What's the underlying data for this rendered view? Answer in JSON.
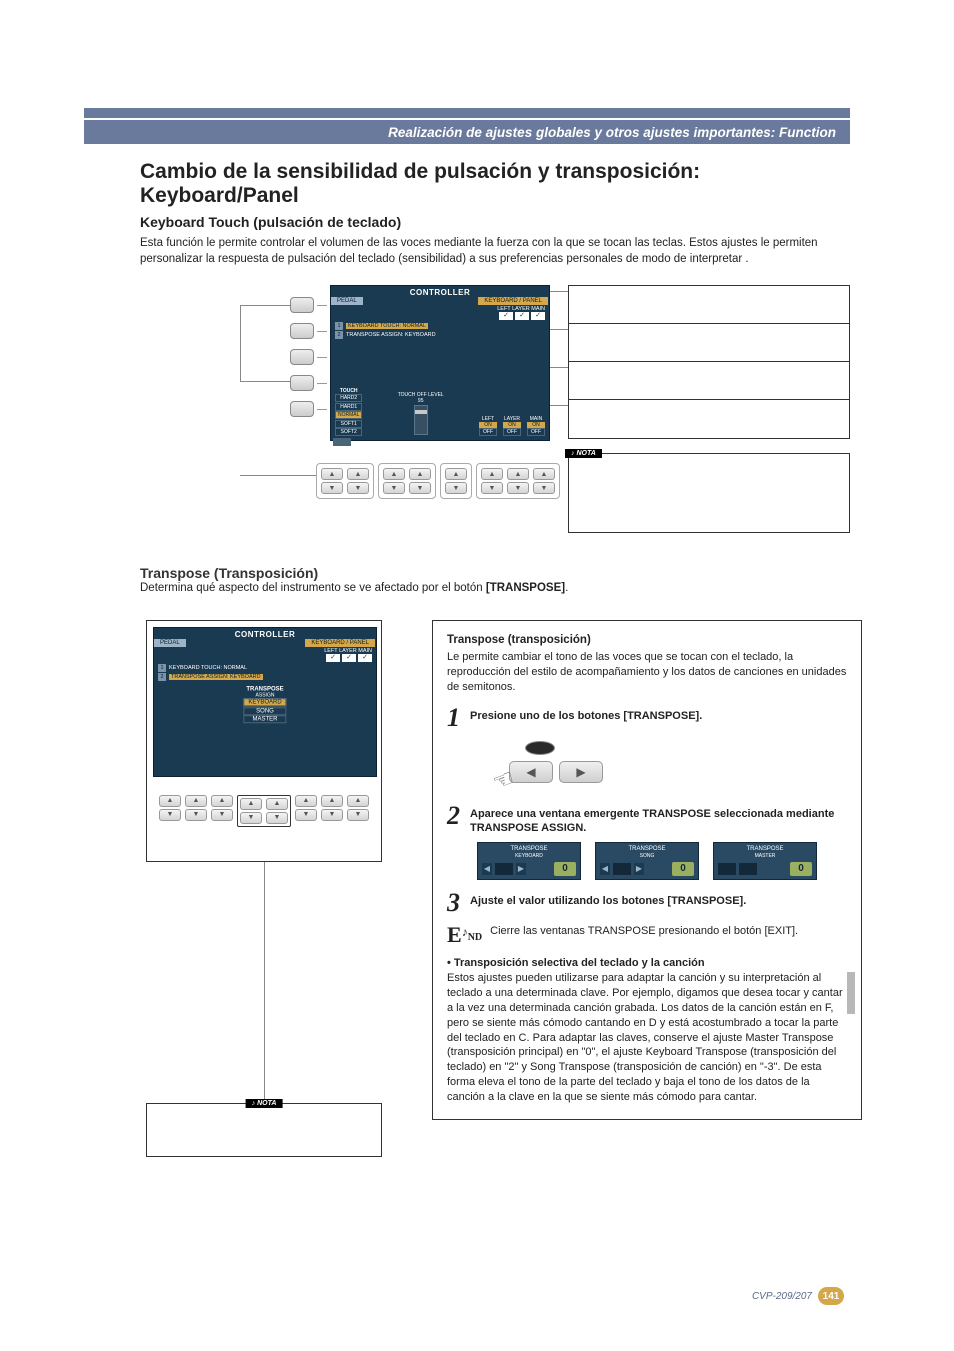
{
  "header": {
    "ribbon": "Realización de ajustes globales y otros ajustes importantes: Function"
  },
  "section1": {
    "title": "Cambio de la sensibilidad de pulsación y transposición: Keyboard/Panel",
    "subhead": "Keyboard Touch (pulsación de teclado)",
    "intro": "Esta función le permite controlar el volumen de las voces mediante la fuerza con la que se tocan las teclas. Estos ajustes le permiten personalizar la respuesta de pulsación del teclado (sensibilidad) a sus preferencias personales de modo de interpretar ."
  },
  "lcd1": {
    "title": "CONTROLLER",
    "tab_pedal": "PEDAL",
    "tab_kbd": "KEYBOARD / PANEL",
    "sub_checks": "LEFT  LAYER  MAIN",
    "row1_num": "1",
    "row1": "KEYBOARD TOUCH: NORMAL",
    "row2_num": "2",
    "row2": "TRANSPOSE ASSIGN: KEYBOARD",
    "touch_label": "TOUCH",
    "touch_opts": [
      "HARD2",
      "HARD1",
      "NORMAL",
      "SOFT1",
      "SOFT2"
    ],
    "touch_selected": "NORMAL",
    "touchoff_label": "TOUCH OFF LEVEL",
    "touchoff_value": "95",
    "cols": [
      {
        "name": "LEFT",
        "on": "ON",
        "off": "OFF",
        "state": "on"
      },
      {
        "name": "LAYER",
        "on": "ON",
        "off": "OFF",
        "state": "on"
      },
      {
        "name": "MAIN",
        "on": "ON",
        "off": "OFF",
        "state": "on"
      }
    ]
  },
  "nota": {
    "badge": "NOTA"
  },
  "section2": {
    "subhead": "Transpose (Transposición)",
    "intro_pre": "Determina qué aspecto del instrumento se ve afectado por el botón ",
    "intro_bold": "[TRANSPOSE]",
    "intro_post": "."
  },
  "lcd2": {
    "title": "CONTROLLER",
    "tab_pedal": "PEDAL",
    "tab_kbd": "KEYBOARD / PANEL",
    "row1_num": "1",
    "row1": "KEYBOARD TOUCH: NORMAL",
    "row2_num": "2",
    "row2": "TRANSPOSE ASSIGN: KEYBOARD",
    "t_label": "TRANSPOSE",
    "t_sub": "ASSIGN",
    "t_opts": [
      "KEYBOARD",
      "SONG",
      "MASTER"
    ],
    "t_selected": "KEYBOARD"
  },
  "explain": {
    "h3": "Transpose (transposición)",
    "p1": "Le permite cambiar el tono de las voces que se tocan con el teclado, la reproducción del estilo de acompañamiento y los datos de canciones en unidades de semitonos.",
    "step1": "Presione uno de los botones [TRANSPOSE].",
    "step2": "Aparece una ventana emergente TRANSPOSE seleccionada mediante TRANSPOSE ASSIGN.",
    "step3": "Ajuste el valor utilizando los botones [TRANSPOSE].",
    "end": "Cierre las ventanas TRANSPOSE presionando el botón [EXIT].",
    "bullet": "• Transposición selectiva del teclado y la canción",
    "p2": "Estos ajustes pueden utilizarse para adaptar la canción y su interpretación al teclado a una determinada clave. Por ejemplo, digamos que desea tocar y cantar a la vez una determinada canción grabada. Los datos de la canción están en F, pero se siente más cómodo cantando en D y está acostumbrado a tocar la parte del teclado en C. Para adaptar las claves, conserve el ajuste Master Transpose (transposición principal) en \"0\", el ajuste Keyboard Transpose (transposición del teclado) en \"2\" y Song Transpose (transposición de canción) en \"-3\". De esta forma eleva el tono de la parte del teclado y baja el tono de los datos de la canción a la clave en la que se siente más cómodo para cantar."
  },
  "popups": [
    {
      "l1": "TRANSPOSE",
      "l2": "KEYBOARD",
      "val": "0"
    },
    {
      "l1": "TRANSPOSE",
      "l2": "SONG",
      "val": "0"
    },
    {
      "l1": "TRANSPOSE",
      "l2": "MASTER",
      "val": "0"
    }
  ],
  "footer": {
    "model": "CVP-209/207",
    "page": "141"
  },
  "glyphs": {
    "up": "▲",
    "down": "▼",
    "left": "◀",
    "right": "▶",
    "check": "✓",
    "hand": "☞",
    "end_E": "E",
    "end_ND": "ND"
  }
}
